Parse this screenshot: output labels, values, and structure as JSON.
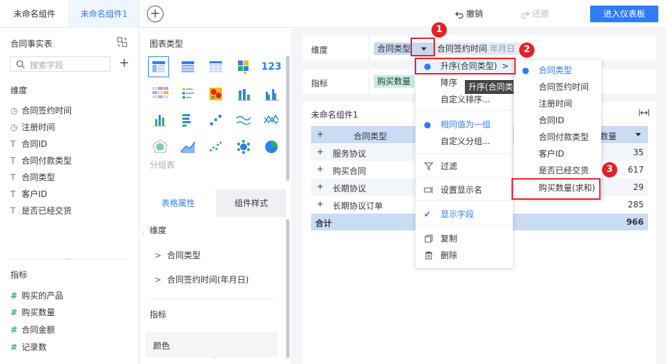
{
  "tabs": [
    "未命名组件",
    "未命名组件1"
  ],
  "toolbar": {
    "undo": "撤销",
    "redo": "还原",
    "enter": "进入仪表板"
  },
  "left": {
    "title": "合同事实表",
    "search_placeholder": "搜索字段",
    "dim_header": "维度",
    "dimensions": [
      {
        "icon": "clock-icon",
        "label": "合同签约时间"
      },
      {
        "icon": "clock-icon",
        "label": "注册时间"
      },
      {
        "icon": "text-type-icon",
        "label": "合同ID"
      },
      {
        "icon": "text-type-icon",
        "label": "合同付款类型"
      },
      {
        "icon": "text-type-icon",
        "label": "合同类型"
      },
      {
        "icon": "text-type-icon",
        "label": "客户ID"
      },
      {
        "icon": "text-type-icon",
        "label": "是否已经交货"
      }
    ],
    "measure_header": "指标",
    "measures": [
      {
        "icon": "hash-icon",
        "label": "购买的产品"
      },
      {
        "icon": "hash-icon",
        "label": "购买数量"
      },
      {
        "icon": "hash-icon",
        "label": "合同金额"
      },
      {
        "icon": "hash-icon",
        "label": "记录数"
      }
    ]
  },
  "chart_panel": {
    "title": "图表类型",
    "group_label": "分组表",
    "tabs": [
      "表格属性",
      "组件样式"
    ],
    "dim_header": "维度",
    "dim_items": [
      "合同类型",
      "合同签约时间(年月日)"
    ],
    "measure_header": "指标",
    "color_label": "颜色"
  },
  "main": {
    "dim_label": "维度",
    "measure_label": "指标",
    "dim_pill1": "合同类型",
    "dim_pill2": "合同签约时间",
    "dim_pill2_sub": "年月日",
    "measure_pill": "购买数量",
    "component_title": "未命名组件1",
    "table": {
      "col1": "合同类型",
      "col2": "数量",
      "rows": [
        {
          "name": "服务协议",
          "value": "35"
        },
        {
          "name": "购买合同",
          "value": "617"
        },
        {
          "name": "长期协议",
          "value": "29"
        },
        {
          "name": "长期协议订单",
          "value": "285"
        }
      ],
      "total_label": "合计",
      "total_value": "966"
    }
  },
  "context_menu": {
    "items": [
      "升序(合同类型)",
      "降序",
      "自定义排序...",
      "相同值为一组",
      "自定义分组...",
      "过滤",
      "设置显示名",
      "显示字段",
      "复制",
      "删除"
    ]
  },
  "tooltip": "升序(合同类型)",
  "submenu": [
    "合同类型",
    "合同签约时间",
    "注册时间",
    "合同ID",
    "合同付款类型",
    "客户ID",
    "是否已经交货",
    "购买数量(求和)"
  ],
  "badges": [
    "1",
    "2",
    "3"
  ],
  "colors": {
    "accent": "#2f7df6",
    "highlight": "#e0232a"
  }
}
